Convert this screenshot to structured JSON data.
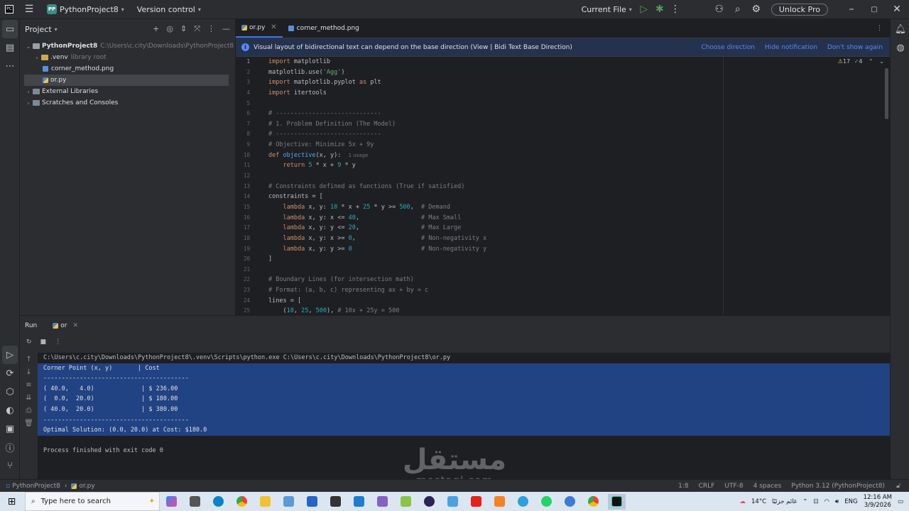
{
  "titlebar": {
    "project_badge": "PP",
    "project_name": "PythonProject8",
    "vcs": "Version control",
    "run_config": "Current File",
    "unlock": "Unlock Pro"
  },
  "project_panel": {
    "title": "Project",
    "root_name": "PythonProject8",
    "root_path": "C:\\Users\\c.city\\Downloads\\PythonProject8",
    "items": [
      {
        "label": ".venv",
        "note": "library root"
      },
      {
        "label": "corner_method.png"
      },
      {
        "label": "or.py"
      },
      {
        "label": "External Libraries"
      },
      {
        "label": "Scratches and Consoles"
      }
    ]
  },
  "editor": {
    "tabs": [
      {
        "label": "or.py"
      },
      {
        "label": "corner_method.png"
      }
    ],
    "notification": {
      "text": "Visual layout of bidirectional text can depend on the base direction (View | Bidi Text Base Direction)",
      "actions": [
        "Choose direction",
        "Hide notification",
        "Don't show again"
      ]
    },
    "inspections": {
      "warnings": "17",
      "checks": "4"
    },
    "usage_hint": "1 usage",
    "line_numbers": [
      "1",
      "2",
      "3",
      "4",
      "5",
      "6",
      "7",
      "8",
      "9",
      "10",
      "11",
      "12",
      "13",
      "14",
      "15",
      "16",
      "17",
      "18",
      "19",
      "20",
      "21",
      "22",
      "23",
      "24",
      "25"
    ],
    "code": {
      "l1": "import matplotlib",
      "l2": "matplotlib.use('Agg')",
      "l3": "import matplotlib.pyplot as plt",
      "l4": "import itertools",
      "l6": "# -----------------------------",
      "l7": "# 1. Problem Definition (The Model)",
      "l8": "# -----------------------------",
      "l9": "# Objective: Minimize 5x + 9y",
      "l10": "def objective(x, y):",
      "l11": "    return 5 * x + 9 * y",
      "l13": "# Constraints defined as functions (True if satisfied)",
      "l14": "constraints = [",
      "l15": "    lambda x, y: 10 * x + 25 * y >= 500,  # Demand",
      "l16": "    lambda x, y: x <= 40,                 # Max Small",
      "l17": "    lambda x, y: y <= 20,                 # Max Large",
      "l18": "    lambda x, y: x >= 0,                  # Non-negativity x",
      "l19": "    lambda x, y: y >= 0                   # Non-negativity y",
      "l20": "]",
      "l22": "# Boundary Lines (for intersection math)",
      "l23": "# Format: (a, b, c) representing ax + by = c",
      "l24": "lines = [",
      "l25": "    (10, 25, 500), # 10x + 25y = 500"
    }
  },
  "run_panel": {
    "title": "Run",
    "tab": "or",
    "console": [
      "C:\\Users\\c.city\\Downloads\\PythonProject8\\.venv\\Scripts\\python.exe C:\\Users\\c.city\\Downloads\\PythonProject8\\or.py",
      "Corner Point (x, y)       | Cost",
      "----------------------------------------",
      "( 40.0,   4.0)             | $ 236.00",
      "(  0.0,  20.0)             | $ 180.00",
      "( 40.0,  20.0)             | $ 380.00",
      "----------------------------------------",
      "Optimal Solution: (0.0, 20.0) at Cost: $180.0",
      "",
      "Process finished with exit code 0"
    ]
  },
  "statusbar": {
    "breadcrumb_project": "PythonProject8",
    "breadcrumb_file": "or.py",
    "position": "1:8",
    "line_sep": "CRLF",
    "encoding": "UTF-8",
    "indent": "4 spaces",
    "interpreter": "Python 3.12 (PythonProject8)"
  },
  "taskbar": {
    "search_placeholder": "Type here to search",
    "weather": "14°C",
    "weather_text": "غائم جزئيًا",
    "lang": "ENG",
    "time": "12:16 AM",
    "date": "3/9/2026"
  },
  "watermark": {
    "arabic": "مستقل",
    "latin": "mostaql.com"
  },
  "colors": {
    "accent": "#3574f0",
    "selection": "#214283",
    "keyword": "#cf8e6d",
    "string": "#6aab73",
    "number": "#2aacb8",
    "comment": "#7a7e85",
    "function": "#56a8f5"
  }
}
